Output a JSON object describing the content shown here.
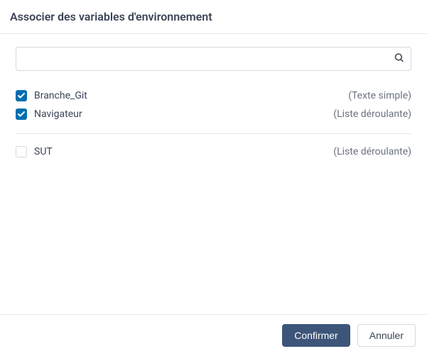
{
  "dialog": {
    "title": "Associer des variables d'environnement"
  },
  "search": {
    "value": "",
    "placeholder": ""
  },
  "groups": {
    "checked": [
      {
        "label": "Branche_Git",
        "type": "(Texte simple)"
      },
      {
        "label": "Navigateur",
        "type": "(Liste déroulante)"
      }
    ],
    "unchecked": [
      {
        "label": "SUT",
        "type": "(Liste déroulante)"
      }
    ]
  },
  "buttons": {
    "confirm": "Confirmer",
    "cancel": "Annuler"
  }
}
